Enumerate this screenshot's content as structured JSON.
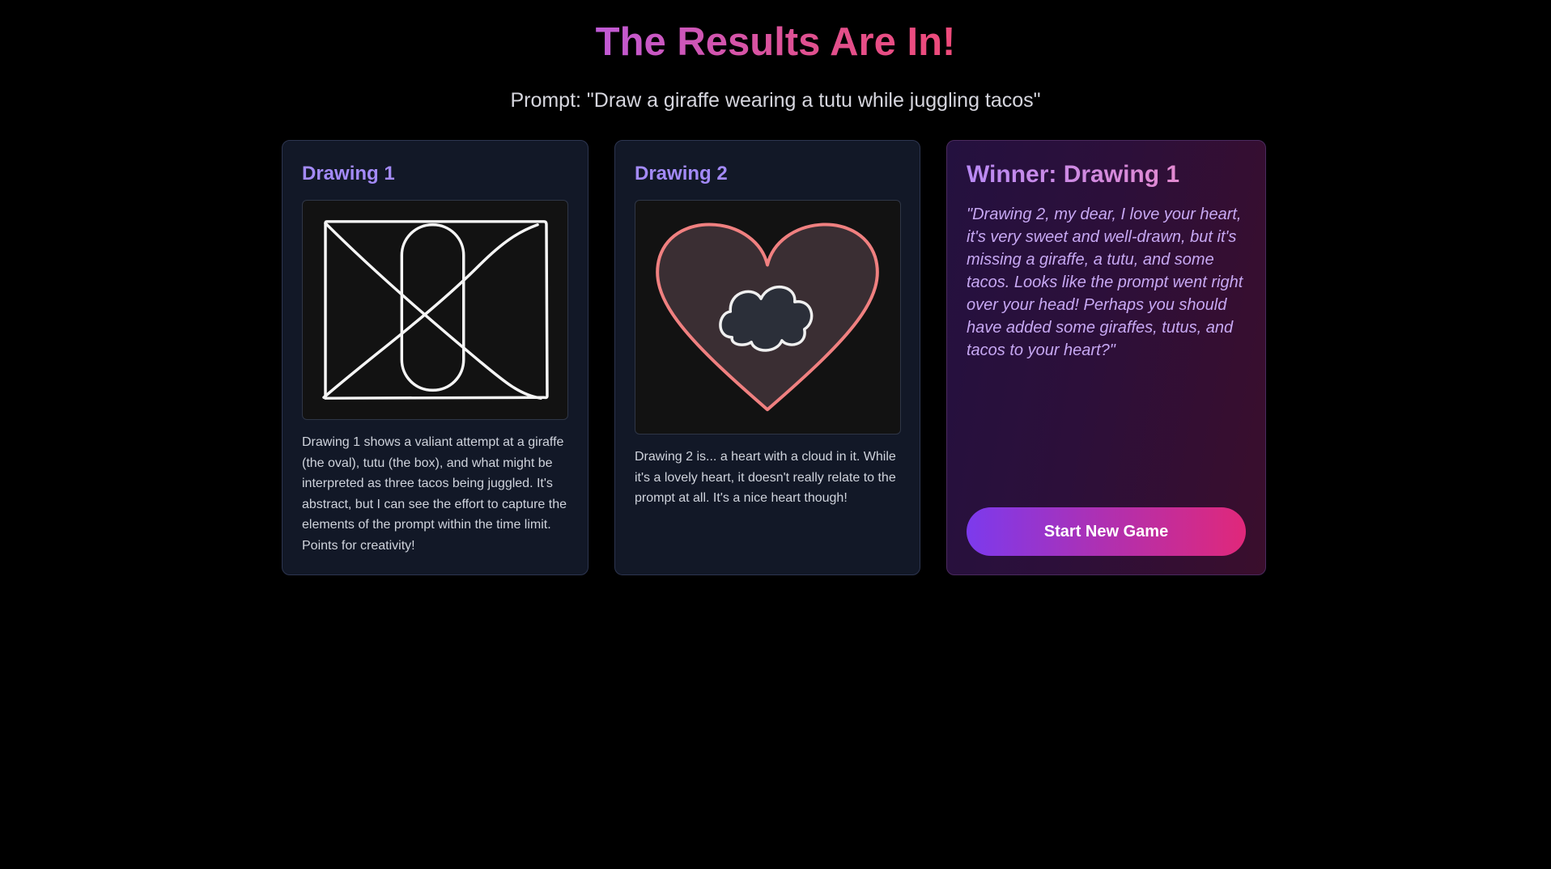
{
  "header": {
    "title": "The Results Are In!",
    "prompt": "Prompt: \"Draw a giraffe wearing a tutu while juggling tacos\""
  },
  "drawings": [
    {
      "heading": "Drawing 1",
      "description": "Drawing 1 shows a valiant attempt at a giraffe (the oval), tutu (the box), and what might be interpreted as three tacos being juggled. It's abstract, but I can see the effort to capture the elements of the prompt within the time limit. Points for creativity!"
    },
    {
      "heading": "Drawing 2",
      "description": "Drawing 2 is... a heart with a cloud in it. While it's a lovely heart, it doesn't really relate to the prompt at all. It's a nice heart though!"
    }
  ],
  "winner": {
    "heading": "Winner: Drawing 1",
    "quote": "\"Drawing 2, my dear, I love your heart, it's very sweet and well-drawn, but it's missing a giraffe, a tutu, and some tacos. Looks like the prompt went right over your head! Perhaps you should have added some giraffes, tutus, and tacos to your heart?\"",
    "button_label": "Start New Game"
  },
  "colors": {
    "background": "#000000",
    "card_background": "#121827",
    "accent_purple": "#a38af7",
    "accent_pink": "#e0287a",
    "heart_stroke": "#f08080",
    "sketch_stroke": "#f5f5f5"
  }
}
